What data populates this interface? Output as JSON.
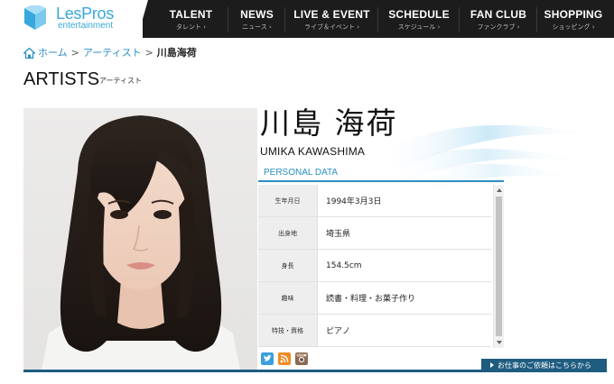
{
  "header": {
    "logo_text": "LesPros",
    "logo_sub": "entertainment",
    "nav": [
      {
        "main": "TALENT",
        "sub": "タレント ›"
      },
      {
        "main": "NEWS",
        "sub": "ニュース ›"
      },
      {
        "main": "LIVE & EVENT",
        "sub": "ライブ＆イベント ›"
      },
      {
        "main": "SCHEDULE",
        "sub": "スケジュール ›"
      },
      {
        "main": "FAN CLUB",
        "sub": "ファンクラブ ›"
      },
      {
        "main": "SHOPPING",
        "sub": "ショッピング ›"
      }
    ]
  },
  "breadcrumb": {
    "home": "ホーム",
    "sep": ">",
    "artists": "アーティスト",
    "current": "川島海荷"
  },
  "page": {
    "title": "ARTISTS",
    "title_sub": "アーティスト"
  },
  "artist": {
    "name_ja": "川島 海荷",
    "name_en": "UMIKA KAWASHIMA"
  },
  "personal_data": {
    "title": "PERSONAL DATA",
    "rows": [
      {
        "label": "生年月日",
        "value": "1994年3月3日"
      },
      {
        "label": "出身地",
        "value": "埼玉県"
      },
      {
        "label": "身長",
        "value": "154.5cm"
      },
      {
        "label": "趣味",
        "value": "読書・料理・お菓子作り"
      },
      {
        "label": "特技・資格",
        "value": "ピアノ"
      }
    ]
  },
  "social_icons": [
    "twitter-icon",
    "blog-icon",
    "instagram-icon"
  ],
  "request_button": "お仕事のご依頼はこちらから",
  "colors": {
    "accent_blue": "#2a8fc4",
    "header_bg": "#1c1c1c",
    "bottom_bar": "#1e5c80"
  }
}
